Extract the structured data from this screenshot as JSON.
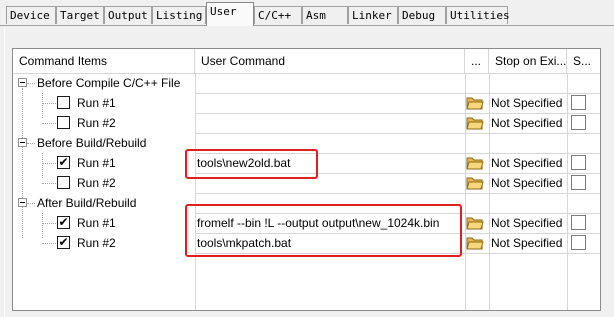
{
  "tabs": [
    {
      "label": "Device",
      "active": false
    },
    {
      "label": "Target",
      "active": false
    },
    {
      "label": "Output",
      "active": false
    },
    {
      "label": "Listing",
      "active": false
    },
    {
      "label": "User",
      "active": true
    },
    {
      "label": "C/C++",
      "active": false
    },
    {
      "label": "Asm",
      "active": false
    },
    {
      "label": "Linker",
      "active": false
    },
    {
      "label": "Debug",
      "active": false
    },
    {
      "label": "Utilities",
      "active": false
    }
  ],
  "grid": {
    "headers": {
      "command_items": "Command Items",
      "user_command": "User Command",
      "browse": "...",
      "stop_on_exit": "Stop on Exi...",
      "s": "S..."
    },
    "groups": [
      {
        "label": "Before Compile C/C++ File",
        "expanded": true,
        "rows": [
          {
            "label": "Run #1",
            "checked": false,
            "command": "",
            "stop": "Not Specified",
            "s_checked": false
          },
          {
            "label": "Run #2",
            "checked": false,
            "command": "",
            "stop": "Not Specified",
            "s_checked": false
          }
        ]
      },
      {
        "label": "Before Build/Rebuild",
        "expanded": true,
        "rows": [
          {
            "label": "Run #1",
            "checked": true,
            "command": "tools\\new2old.bat",
            "stop": "Not Specified",
            "s_checked": false
          },
          {
            "label": "Run #2",
            "checked": false,
            "command": "",
            "stop": "Not Specified",
            "s_checked": false
          }
        ]
      },
      {
        "label": "After Build/Rebuild",
        "expanded": true,
        "rows": [
          {
            "label": "Run #1",
            "checked": true,
            "command": "fromelf --bin !L --output output\\new_1024k.bin",
            "stop": "Not Specified",
            "s_checked": false
          },
          {
            "label": "Run #2",
            "checked": true,
            "command": "tools\\mkpatch.bat",
            "stop": "Not Specified",
            "s_checked": false
          }
        ]
      }
    ]
  },
  "colors": {
    "highlight": "#e02020",
    "folder": "#e8b84a"
  },
  "icons": {
    "browse": "folder-open-icon",
    "collapse": "tree-collapse-icon"
  }
}
